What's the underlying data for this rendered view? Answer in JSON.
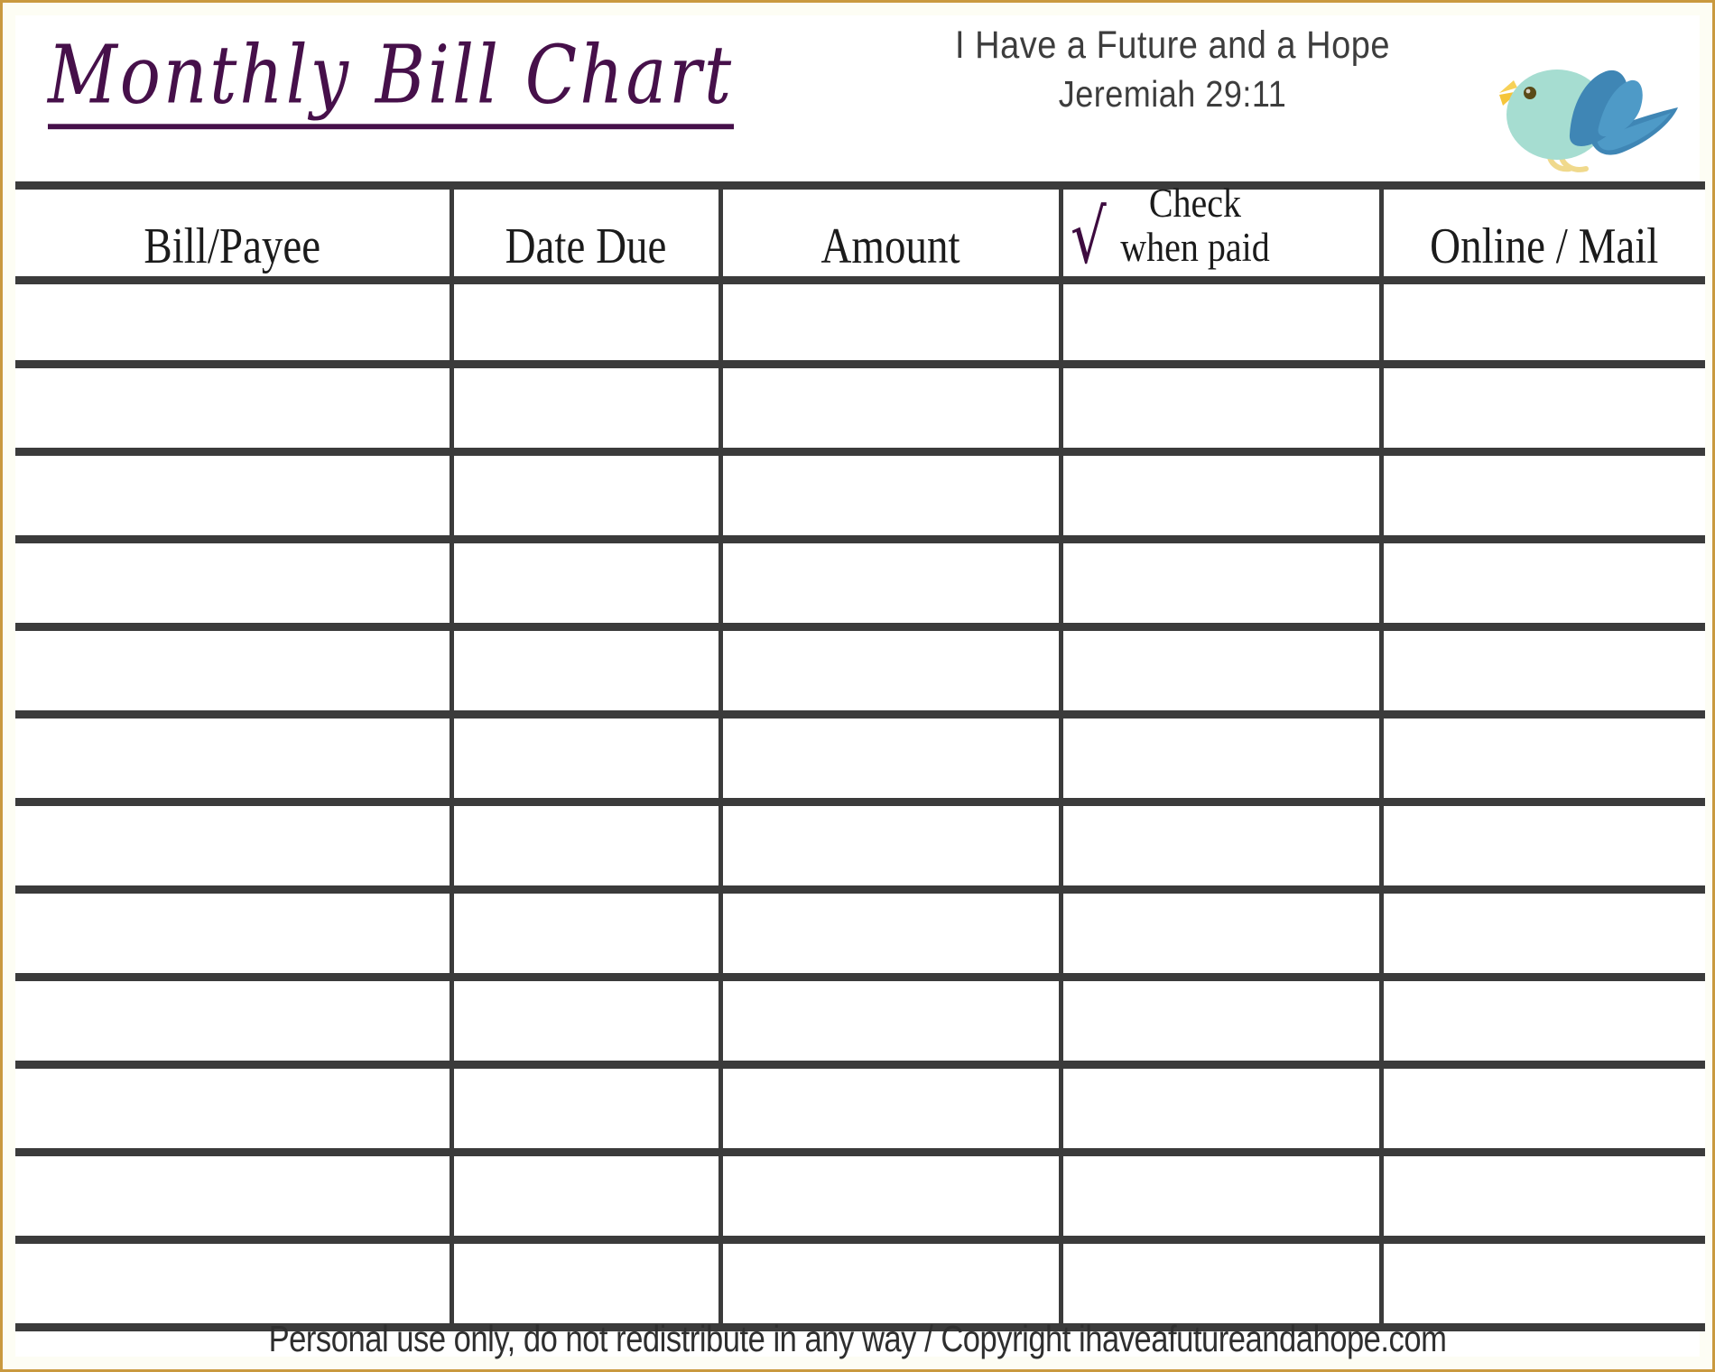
{
  "header": {
    "title": "Monthly Bill Chart",
    "verse_line1": "I Have a Future and a Hope",
    "verse_line2": "Jeremiah 29:11",
    "bird_icon": "bluebird-icon",
    "title_color": "#46104a",
    "frame_color": "#c9993f"
  },
  "table": {
    "columns": [
      {
        "label": "Bill/Payee"
      },
      {
        "label": "Date Due"
      },
      {
        "label": "Amount"
      },
      {
        "label": "Check",
        "label2": "when paid",
        "check_glyph": "√",
        "check_color": "#3d0b3f"
      },
      {
        "label": "Online / Mail"
      }
    ],
    "row_count": 12,
    "rows": [
      {
        "bill": "",
        "date": "",
        "amount": "",
        "check": "",
        "method": ""
      },
      {
        "bill": "",
        "date": "",
        "amount": "",
        "check": "",
        "method": ""
      },
      {
        "bill": "",
        "date": "",
        "amount": "",
        "check": "",
        "method": ""
      },
      {
        "bill": "",
        "date": "",
        "amount": "",
        "check": "",
        "method": ""
      },
      {
        "bill": "",
        "date": "",
        "amount": "",
        "check": "",
        "method": ""
      },
      {
        "bill": "",
        "date": "",
        "amount": "",
        "check": "",
        "method": ""
      },
      {
        "bill": "",
        "date": "",
        "amount": "",
        "check": "",
        "method": ""
      },
      {
        "bill": "",
        "date": "",
        "amount": "",
        "check": "",
        "method": ""
      },
      {
        "bill": "",
        "date": "",
        "amount": "",
        "check": "",
        "method": ""
      },
      {
        "bill": "",
        "date": "",
        "amount": "",
        "check": "",
        "method": ""
      },
      {
        "bill": "",
        "date": "",
        "amount": "",
        "check": "",
        "method": ""
      },
      {
        "bill": "",
        "date": "",
        "amount": "",
        "check": "",
        "method": ""
      }
    ],
    "grid_color": "#3b3b3b"
  },
  "footer": {
    "note": "Personal use only, do not redistribute in any way / Copyright ihaveafutureandahope.com"
  }
}
